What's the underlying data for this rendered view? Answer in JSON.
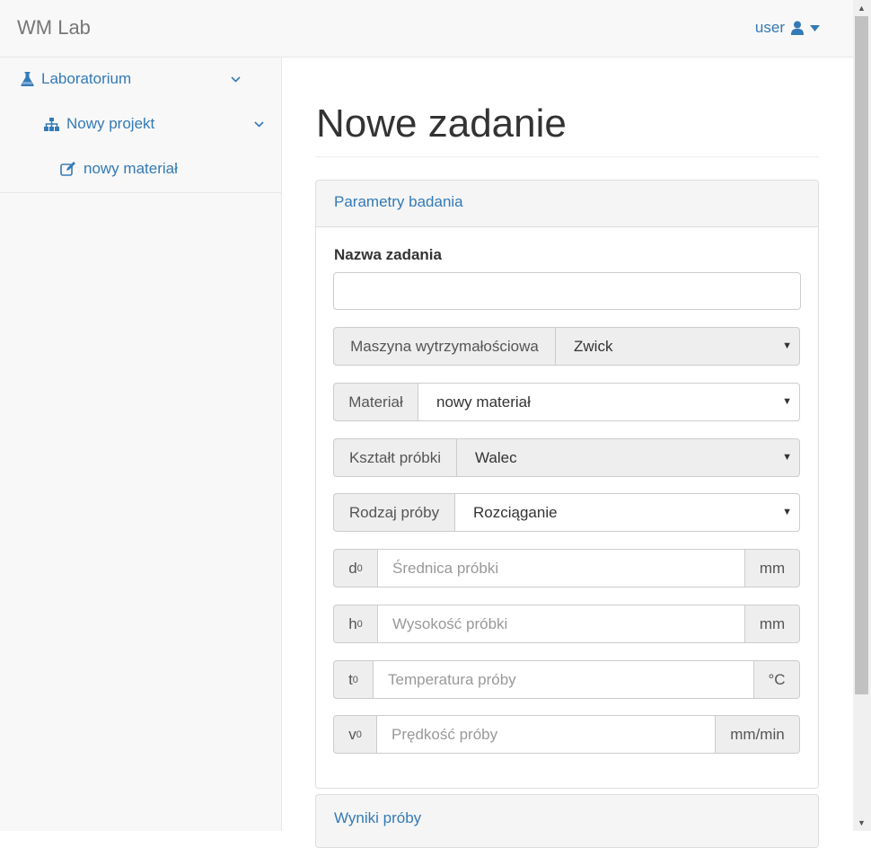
{
  "navbar": {
    "brand": "WM Lab",
    "user_label": "user"
  },
  "sidebar": {
    "items": [
      {
        "label": "Laboratorium"
      },
      {
        "label": "Nowy projekt"
      },
      {
        "label": "nowy materiał"
      }
    ]
  },
  "main": {
    "title": "Nowe zadanie",
    "panel1": {
      "heading": "Parametry badania",
      "name_label": "Nazwa zadania",
      "name_value": "",
      "machine": {
        "label": "Maszyna wytrzymałościowa",
        "value": "Zwick"
      },
      "material": {
        "label": "Materiał",
        "value": "nowy materiał"
      },
      "shape": {
        "label": "Kształt próbki",
        "value": "Walec"
      },
      "test_type": {
        "label": "Rodzaj próby",
        "value": "Rozciąganie"
      },
      "d0": {
        "symbol": "d",
        "sub": "0",
        "placeholder": "Średnica próbki",
        "unit": "mm"
      },
      "h0": {
        "symbol": "h",
        "sub": "0",
        "placeholder": "Wysokość próbki",
        "unit": "mm"
      },
      "t0": {
        "symbol": "t",
        "sub": "0",
        "placeholder": "Temperatura próby",
        "unit": "°C"
      },
      "v0": {
        "symbol": "v",
        "sub": "0",
        "placeholder": "Prędkość próby",
        "unit": "mm/min"
      }
    },
    "panel2": {
      "heading": "Wyniki próby"
    }
  }
}
